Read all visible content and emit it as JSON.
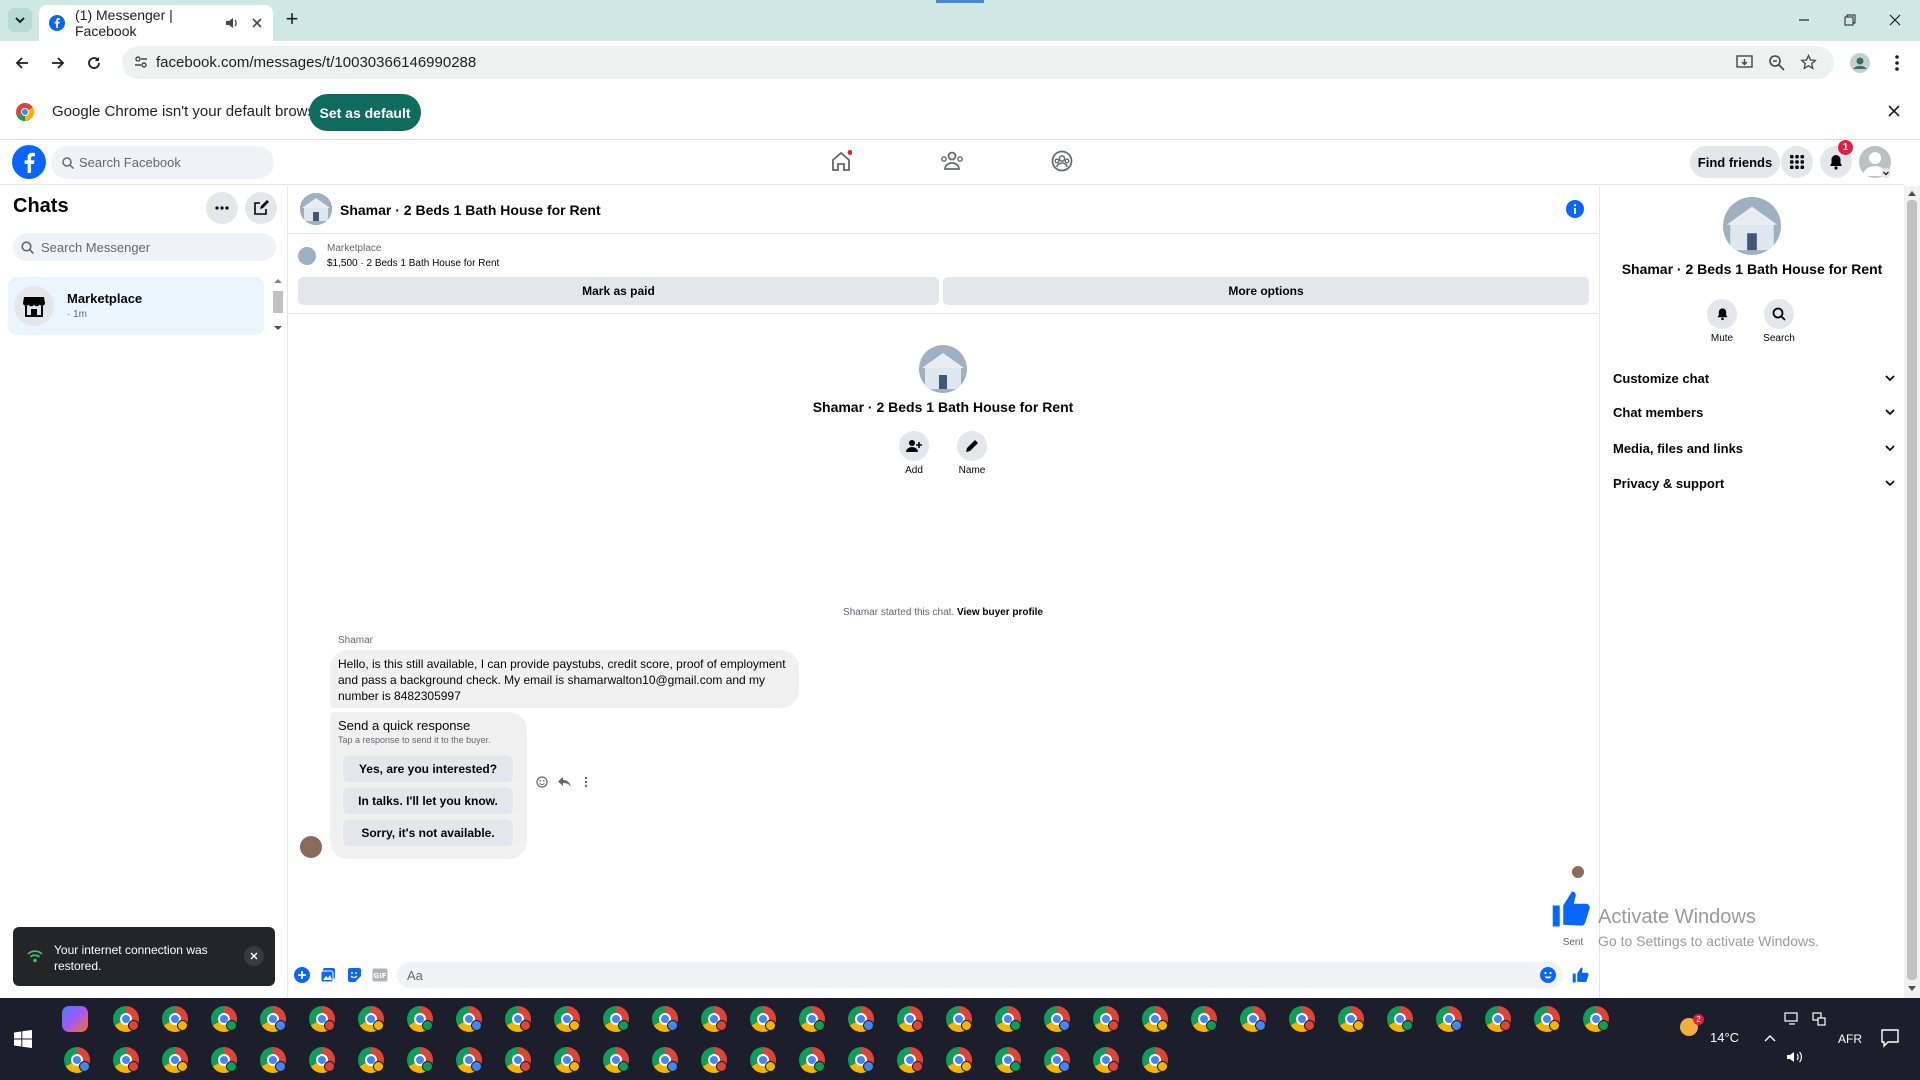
{
  "browser": {
    "tab_title": "(1) Messenger | Facebook",
    "url": "facebook.com/messages/t/10030366146990288",
    "new_tab_symbol": "+",
    "infobar_text": "Google Chrome isn't your default browser",
    "set_default_label": "Set as default"
  },
  "fb": {
    "search_placeholder": "Search Facebook",
    "find_friends_label": "Find friends",
    "notification_count": "1"
  },
  "sidebar": {
    "title": "Chats",
    "search_placeholder": "Search Messenger",
    "chats": [
      {
        "name": "Marketplace",
        "time": "· 1m"
      }
    ]
  },
  "conversation": {
    "title": "Shamar · 2 Beds 1 Bath House for Rent",
    "marketplace_label": "Marketplace",
    "listing": "$1,500 · 2 Beds 1 Bath House for Rent",
    "mark_paid_label": "Mark as paid",
    "more_options_label": "More options",
    "center_name": "Shamar · 2 Beds 1 Bath House for Rent",
    "add_label": "Add",
    "name_label": "Name",
    "started_text": "Shamar started this chat. ",
    "view_buyer_label": "View buyer profile",
    "sender_name": "Shamar",
    "message_text": "Hello, is this still available, I can provide paystubs, credit score, proof of employment and pass a background check. My email is shamarwalton10@gmail.com and my number is 8482305997",
    "quick_response_title": "Send a quick response",
    "quick_response_sub": "Tap a response to send it to the buyer.",
    "quick_responses": [
      "Yes, are you interested?",
      "In talks. I'll let you know.",
      "Sorry, it's not available."
    ],
    "sent_label": "Sent",
    "composer_placeholder": "Aa"
  },
  "details": {
    "name": "Shamar · 2 Beds 1 Bath House for Rent",
    "mute_label": "Mute",
    "search_label": "Search",
    "sections": [
      "Customize chat",
      "Chat members",
      "Media, files and links",
      "Privacy & support"
    ]
  },
  "toast": {
    "text": "Your internet connection was restored."
  },
  "watermark": {
    "title": "Activate Windows",
    "subtitle": "Go to Settings to activate Windows."
  },
  "taskbar": {
    "temperature": "14°C",
    "language": "AFR",
    "notif_count": "2"
  },
  "colors": {
    "fb_blue": "#0866ff",
    "chrome_tab_bg": "#cfe8e3",
    "infobar_button": "#0f6b5e",
    "taskbar": "#1c1e2b"
  }
}
